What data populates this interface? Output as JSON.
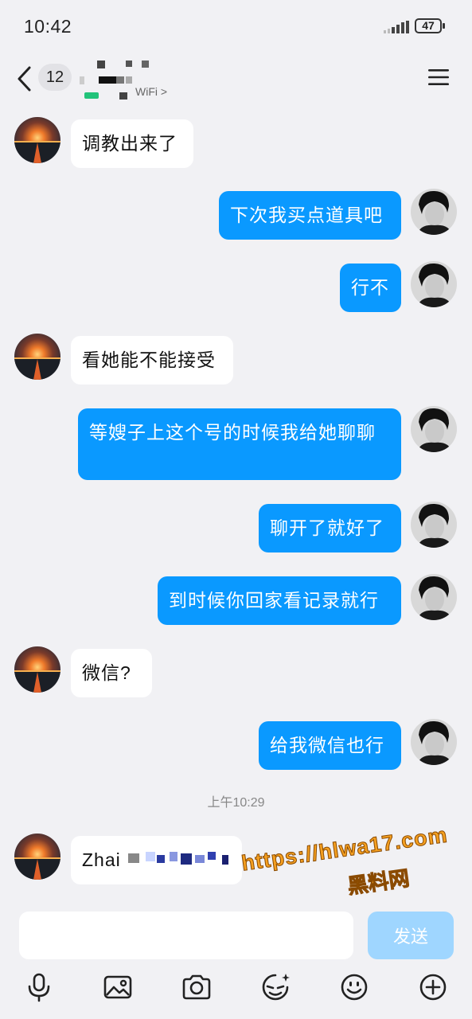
{
  "status_bar": {
    "time": "10:42",
    "battery": "47"
  },
  "header": {
    "unread_count": "12",
    "net_status": "WiFi >"
  },
  "messages": [
    {
      "side": "in",
      "text": "调教出来了"
    },
    {
      "side": "out",
      "text": "下次我买点道具吧"
    },
    {
      "side": "out",
      "text": "行不"
    },
    {
      "side": "in",
      "text": "看她能不能接受"
    },
    {
      "side": "out",
      "text": "等嫂子上这个号的时候我给她聊聊"
    },
    {
      "side": "out",
      "text": "聊开了就好了"
    },
    {
      "side": "out",
      "text": "到时候你回家看记录就行"
    },
    {
      "side": "in",
      "text": "微信?"
    },
    {
      "side": "out",
      "text": "给我微信也行"
    },
    {
      "side": "in",
      "text": "Zhai"
    }
  ],
  "timestamp": "上午10:29",
  "watermark": {
    "url": "https://hlwa17.com",
    "name": "黑料网"
  },
  "input": {
    "placeholder": ""
  },
  "send_label": "发送",
  "toolbar": [
    "microphone-icon",
    "image-icon",
    "camera-icon",
    "sticker-icon",
    "emoji-icon",
    "plus-icon"
  ]
}
